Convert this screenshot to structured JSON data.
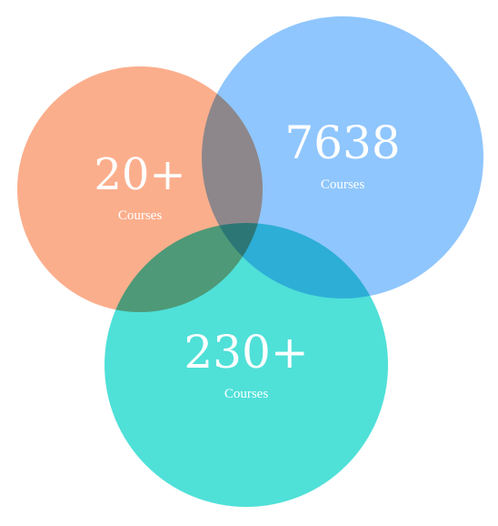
{
  "colors": {
    "orange": "#fbae8c",
    "blue": "#8fc6fd",
    "teal": "#4fe0d8",
    "text": "#ffffff"
  },
  "stats": [
    {
      "value": "20+",
      "caption": "Courses",
      "color": "orange"
    },
    {
      "value": "7638",
      "caption": "Courses",
      "color": "blue"
    },
    {
      "value": "230+",
      "caption": "Courses",
      "color": "teal"
    }
  ]
}
